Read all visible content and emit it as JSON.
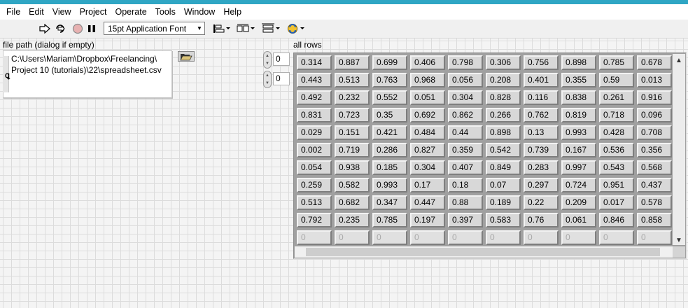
{
  "menu": [
    "File",
    "Edit",
    "View",
    "Project",
    "Operate",
    "Tools",
    "Window",
    "Help"
  ],
  "toolbar": {
    "font_selector": "15pt Application Font",
    "buttons": [
      "run-arrow-icon",
      "run-continuously-icon",
      "abort-icon",
      "pause-icon",
      "align-objects-icon",
      "distribute-objects-icon",
      "resize-objects-icon",
      "reorder-icon"
    ]
  },
  "file_path": {
    "label": "file path (dialog if empty)",
    "value_line1": "C:\\Users\\Mariam\\Dropbox\\Freelancing\\",
    "value_line2": "Project 10 (tutorials)\\22\\spreadsheet.csv"
  },
  "array_index": {
    "row": "0",
    "col": "0"
  },
  "all_rows": {
    "label": "all rows",
    "rows": [
      [
        "0.314",
        "0.887",
        "0.699",
        "0.406",
        "0.798",
        "0.306",
        "0.756",
        "0.898",
        "0.785",
        "0.678"
      ],
      [
        "0.443",
        "0.513",
        "0.763",
        "0.968",
        "0.056",
        "0.208",
        "0.401",
        "0.355",
        "0.59",
        "0.013"
      ],
      [
        "0.492",
        "0.232",
        "0.552",
        "0.051",
        "0.304",
        "0.828",
        "0.116",
        "0.838",
        "0.261",
        "0.916"
      ],
      [
        "0.831",
        "0.723",
        "0.35",
        "0.692",
        "0.862",
        "0.266",
        "0.762",
        "0.819",
        "0.718",
        "0.096"
      ],
      [
        "0.029",
        "0.151",
        "0.421",
        "0.484",
        "0.44",
        "0.898",
        "0.13",
        "0.993",
        "0.428",
        "0.708"
      ],
      [
        "0.002",
        "0.719",
        "0.286",
        "0.827",
        "0.359",
        "0.542",
        "0.739",
        "0.167",
        "0.536",
        "0.356"
      ],
      [
        "0.054",
        "0.938",
        "0.185",
        "0.304",
        "0.407",
        "0.849",
        "0.283",
        "0.997",
        "0.543",
        "0.568"
      ],
      [
        "0.259",
        "0.582",
        "0.993",
        "0.17",
        "0.18",
        "0.07",
        "0.297",
        "0.724",
        "0.951",
        "0.437"
      ],
      [
        "0.513",
        "0.682",
        "0.347",
        "0.447",
        "0.88",
        "0.189",
        "0.22",
        "0.209",
        "0.017",
        "0.578"
      ],
      [
        "0.792",
        "0.235",
        "0.785",
        "0.197",
        "0.397",
        "0.583",
        "0.76",
        "0.061",
        "0.846",
        "0.858"
      ]
    ],
    "empty_row": [
      "0",
      "0",
      "0",
      "0",
      "0",
      "0",
      "0",
      "0",
      "0",
      "0"
    ]
  }
}
